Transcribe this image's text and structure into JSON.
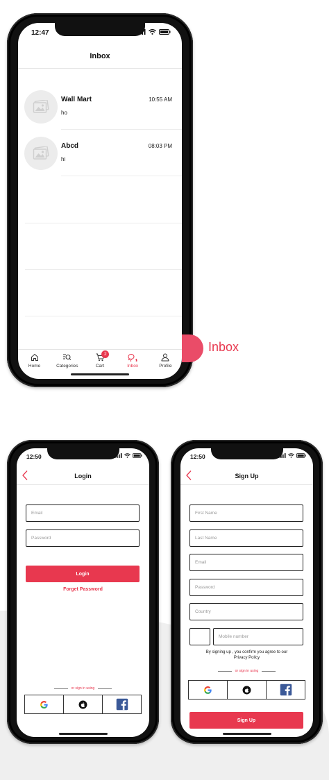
{
  "phone_inbox": {
    "status_time": "12:47",
    "title": "Inbox",
    "messages": [
      {
        "name": "Wall Mart",
        "time": "10:55 AM",
        "text": "ho"
      },
      {
        "name": "Abcd",
        "time": "08:03 PM",
        "text": "hi"
      }
    ],
    "tabs": [
      {
        "label": "Home",
        "icon": "home-icon"
      },
      {
        "label": "Categories",
        "icon": "categories-icon"
      },
      {
        "label": "Cart",
        "icon": "cart-icon",
        "badge": "2"
      },
      {
        "label": "Inbox",
        "icon": "chat-icon",
        "active": true
      },
      {
        "label": "Profile",
        "icon": "user-icon"
      }
    ]
  },
  "feature_label": "Inbox",
  "phone_login": {
    "status_time": "12:50",
    "title": "Login",
    "email_placeholder": "Email",
    "password_placeholder": "Password",
    "login_button": "Login",
    "forgot_password": "Forget Password",
    "or_text": "or sign in using"
  },
  "phone_signup": {
    "status_time": "12:50",
    "title": "Sign Up",
    "first_name_placeholder": "First Name",
    "last_name_placeholder": "Last Name",
    "email_placeholder": "Email",
    "password_placeholder": "Password",
    "country_placeholder": "Country",
    "mobile_placeholder": "Mobile number",
    "terms_line1": "By signing up , you confirm you agree to our",
    "terms_line2": "Privacy Policy",
    "or_text": "or sign in using",
    "signup_button": "Sign Up"
  },
  "colors": {
    "accent": "#e8384f",
    "facebook": "#3b5998"
  }
}
